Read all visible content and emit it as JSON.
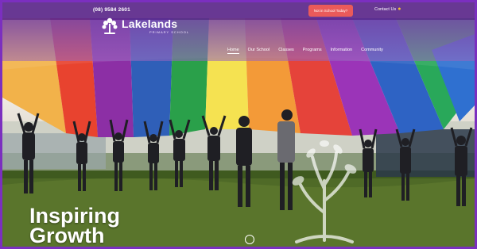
{
  "topbar": {
    "phone": "(08) 9584 2601",
    "enrol_label": "Not in School Today?",
    "contact_label": "Contact Us",
    "contact_icon": "location-pin-icon"
  },
  "brand": {
    "name": "Lakelands",
    "subtitle": "PRIMARY SCHOOL",
    "logo_icon": "tree-logo-icon"
  },
  "nav": {
    "items": [
      {
        "label": "Home",
        "active": true
      },
      {
        "label": "Our School",
        "active": false
      },
      {
        "label": "Classes",
        "active": false
      },
      {
        "label": "Programs",
        "active": false
      },
      {
        "label": "Information",
        "active": false
      },
      {
        "label": "Community",
        "active": false
      }
    ]
  },
  "hero": {
    "headline_line1": "Inspiring",
    "headline_line2": "Growth"
  },
  "colors": {
    "purple": "#7b2fbf",
    "topbar": "#5c288c",
    "enrol_button": "#ea5a5a"
  }
}
